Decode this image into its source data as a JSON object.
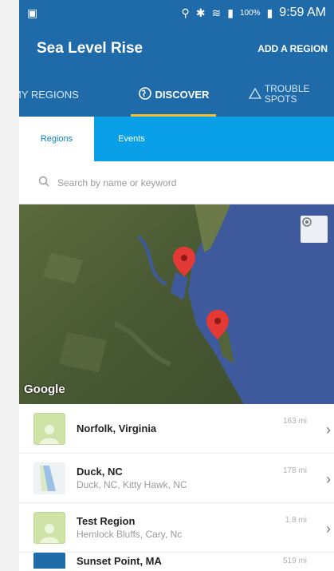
{
  "status_bar": {
    "time": "9:59 AM",
    "battery": "100%"
  },
  "app_bar": {
    "title": "Sea Level Rise",
    "action": "ADD A REGION"
  },
  "tabs": [
    {
      "label": "MY REGIONS",
      "active": false
    },
    {
      "label": "DISCOVER",
      "active": true
    },
    {
      "label": "TROUBLE SPOTS",
      "active": false
    }
  ],
  "subtabs": [
    {
      "label": "Regions",
      "active": true
    },
    {
      "label": "Events",
      "active": false
    }
  ],
  "search": {
    "placeholder": "Search by name or keyword"
  },
  "map": {
    "attribution": "Google"
  },
  "regions": [
    {
      "name": "Norfolk, Virginia",
      "subtitle": "",
      "distance": "163 mi"
    },
    {
      "name": "Duck, NC",
      "subtitle": "Duck, NC, Kitty Hawk, NC",
      "distance": "178 mi"
    },
    {
      "name": "Test Region",
      "subtitle": "Hemlock Bluffs, Cary, Nc",
      "distance": "1.8 mi"
    },
    {
      "name": "Sunset Point, MA",
      "subtitle": "",
      "distance": "519 mi"
    }
  ],
  "colors": {
    "primary": "#1f6aa8",
    "accent": "#0aa0e8",
    "indicator": "#f0c030",
    "pin": "#e53935"
  }
}
